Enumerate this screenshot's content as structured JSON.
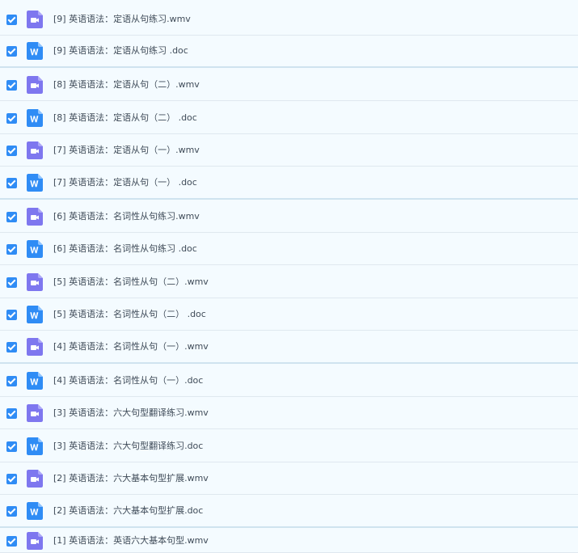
{
  "files": [
    {
      "name": "[9] 英语语法：定语从句练习.wmv",
      "type": "video",
      "checked": true
    },
    {
      "name": "[9] 英语语法：定语从句练习 .doc",
      "type": "doc",
      "checked": true
    },
    {
      "name": "[8] 英语语法：定语从句（二）.wmv",
      "type": "video",
      "checked": true
    },
    {
      "name": "[8] 英语语法：定语从句（二） .doc",
      "type": "doc",
      "checked": true
    },
    {
      "name": "[7] 英语语法：定语从句（一）.wmv",
      "type": "video",
      "checked": true
    },
    {
      "name": "[7] 英语语法：定语从句（一） .doc",
      "type": "doc",
      "checked": true
    },
    {
      "name": "[6] 英语语法：名词性从句练习.wmv",
      "type": "video",
      "checked": true
    },
    {
      "name": "[6] 英语语法：名词性从句练习 .doc",
      "type": "doc",
      "checked": true
    },
    {
      "name": "[5] 英语语法：名词性从句（二）.wmv",
      "type": "video",
      "checked": true
    },
    {
      "name": "[5] 英语语法：名词性从句（二） .doc",
      "type": "doc",
      "checked": true
    },
    {
      "name": "[4] 英语语法：名词性从句（一）.wmv",
      "type": "video",
      "checked": true
    },
    {
      "name": "[4] 英语语法：名词性从句（一）.doc",
      "type": "doc",
      "checked": true
    },
    {
      "name": "[3] 英语语法：六大句型翻译练习.wmv",
      "type": "video",
      "checked": true
    },
    {
      "name": "[3] 英语语法：六大句型翻译练习.doc",
      "type": "doc",
      "checked": true
    },
    {
      "name": "[2] 英语语法：六大基本句型扩展.wmv",
      "type": "video",
      "checked": true
    },
    {
      "name": "[2] 英语语法：六大基本句型扩展.doc",
      "type": "doc",
      "checked": true
    },
    {
      "name": "[1] 英语语法：英语六大基本句型.wmv",
      "type": "video",
      "checked": true
    }
  ],
  "colors": {
    "checkbox": "#2f8cf5",
    "video_icon": "#7e77ef",
    "doc_icon": "#2f8cf5",
    "background": "#f4fbff"
  },
  "icons": {
    "video": "video-file-icon",
    "doc": "word-doc-file-icon",
    "checkbox": "checkmark-icon"
  }
}
